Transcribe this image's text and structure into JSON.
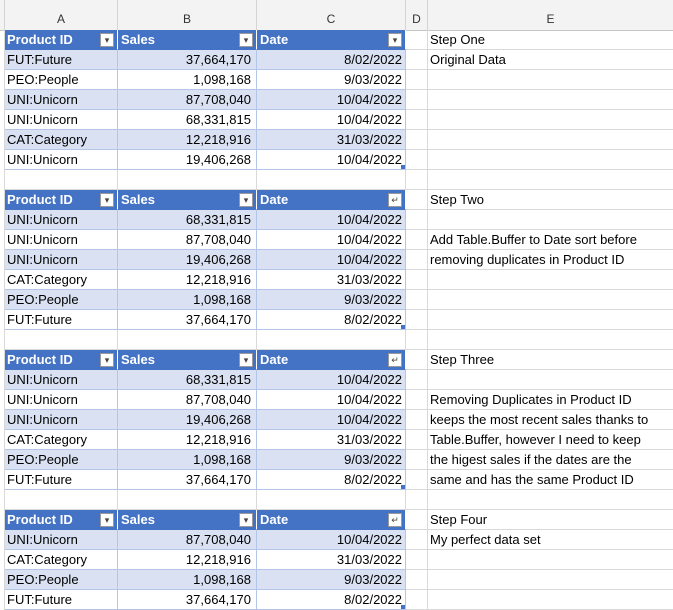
{
  "columns": [
    "A",
    "B",
    "C",
    "D",
    "E"
  ],
  "tables": [
    {
      "headers": [
        "Product ID",
        "Sales",
        "Date"
      ],
      "date_filter_icon": "dropdown-arrow-icon",
      "rows": [
        [
          "FUT:Future",
          "37,664,170",
          "8/02/2022"
        ],
        [
          "PEO:People",
          "1,098,168",
          "9/03/2022"
        ],
        [
          "UNI:Unicorn",
          "87,708,040",
          "10/04/2022"
        ],
        [
          "UNI:Unicorn",
          "68,331,815",
          "10/04/2022"
        ],
        [
          "CAT:Category",
          "12,218,916",
          "31/03/2022"
        ],
        [
          "UNI:Unicorn",
          "19,406,268",
          "10/04/2022"
        ]
      ],
      "notes": [
        "Step One",
        "Original Data",
        "",
        "",
        "",
        "",
        ""
      ]
    },
    {
      "headers": [
        "Product ID",
        "Sales",
        "Date"
      ],
      "date_filter_icon": "sort-descending-icon",
      "rows": [
        [
          "UNI:Unicorn",
          "68,331,815",
          "10/04/2022"
        ],
        [
          "UNI:Unicorn",
          "87,708,040",
          "10/04/2022"
        ],
        [
          "UNI:Unicorn",
          "19,406,268",
          "10/04/2022"
        ],
        [
          "CAT:Category",
          "12,218,916",
          "31/03/2022"
        ],
        [
          "PEO:People",
          "1,098,168",
          "9/03/2022"
        ],
        [
          "FUT:Future",
          "37,664,170",
          "8/02/2022"
        ]
      ],
      "notes": [
        "Step Two",
        "",
        "Add Table.Buffer to Date sort before",
        "removing duplicates in Product ID",
        "",
        "",
        ""
      ]
    },
    {
      "headers": [
        "Product ID",
        "Sales",
        "Date"
      ],
      "date_filter_icon": "sort-descending-icon",
      "rows": [
        [
          "UNI:Unicorn",
          "68,331,815",
          "10/04/2022"
        ],
        [
          "UNI:Unicorn",
          "87,708,040",
          "10/04/2022"
        ],
        [
          "UNI:Unicorn",
          "19,406,268",
          "10/04/2022"
        ],
        [
          "CAT:Category",
          "12,218,916",
          "31/03/2022"
        ],
        [
          "PEO:People",
          "1,098,168",
          "9/03/2022"
        ],
        [
          "FUT:Future",
          "37,664,170",
          "8/02/2022"
        ]
      ],
      "notes": [
        "Step Three",
        "",
        "Removing Duplicates in Product ID",
        "keeps the most recent sales thanks to",
        "Table.Buffer,  however I need to keep",
        "the higest sales if the dates are the",
        "same and has the same Product ID"
      ]
    },
    {
      "headers": [
        "Product ID",
        "Sales",
        "Date"
      ],
      "date_filter_icon": "sort-descending-icon",
      "rows": [
        [
          "UNI:Unicorn",
          "87,708,040",
          "10/04/2022"
        ],
        [
          "CAT:Category",
          "12,218,916",
          "31/03/2022"
        ],
        [
          "PEO:People",
          "1,098,168",
          "9/03/2022"
        ],
        [
          "FUT:Future",
          "37,664,170",
          "8/02/2022"
        ]
      ],
      "notes": [
        "Step Four",
        "My perfect data set",
        "",
        "",
        ""
      ]
    }
  ],
  "colors": {
    "header_fill": "#4472c4",
    "band_fill": "#d9e1f2",
    "gridline": "#d9d9d9"
  }
}
